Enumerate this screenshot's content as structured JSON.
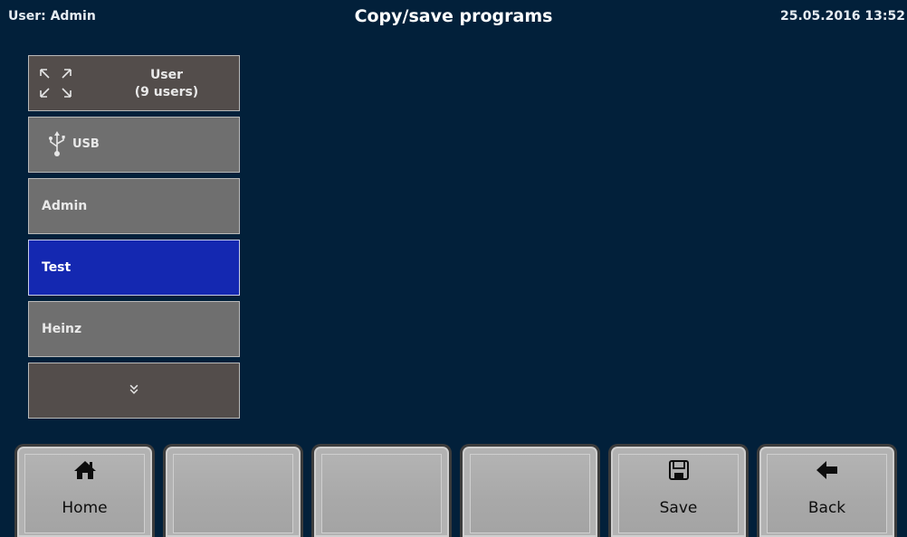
{
  "header": {
    "user": "User: Admin",
    "title": "Copy/save programs",
    "datetime": "25.05.2016 13:52"
  },
  "list": {
    "user_group": {
      "icon": "expand-arrows-icon",
      "title": "User",
      "count": "(9 users)"
    },
    "usb": {
      "icon": "usb-icon",
      "label": "USB"
    },
    "users": [
      {
        "label": "Admin",
        "selected": false
      },
      {
        "label": "Test",
        "selected": true
      },
      {
        "label": "Heinz",
        "selected": false
      }
    ],
    "scroll_down": {
      "icon": "chevron-double-down-icon"
    }
  },
  "function_keys": [
    {
      "label": "Home",
      "icon": "home-icon"
    },
    {
      "label": "",
      "icon": ""
    },
    {
      "label": "",
      "icon": ""
    },
    {
      "label": "",
      "icon": ""
    },
    {
      "label": "Save",
      "icon": "floppy-disk-icon"
    },
    {
      "label": "Back",
      "icon": "arrow-left-icon"
    }
  ],
  "colors": {
    "background": "#02203a",
    "selected": "#1428b1",
    "list_dark": "#534d4b",
    "list_grey": "#6f6f6f"
  }
}
